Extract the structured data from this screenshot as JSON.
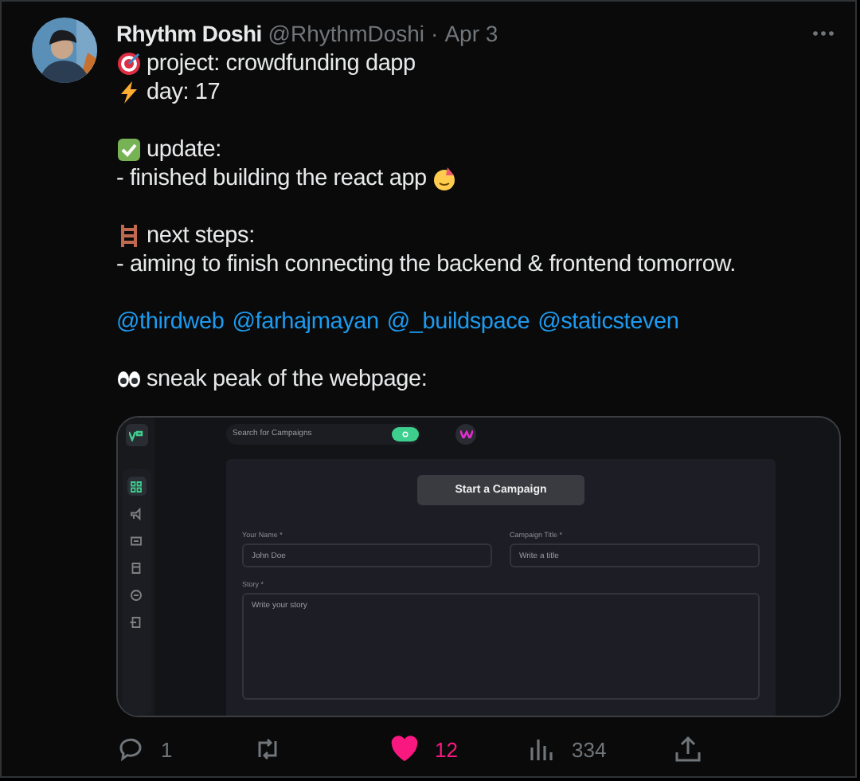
{
  "author": {
    "name": "Rhythm Doshi",
    "handle": "@RhythmDoshi",
    "separator": "·",
    "date": "Apr 3"
  },
  "paragraphs": [
    {
      "lines": [
        "project: crowdfunding dapp",
        "day: 17"
      ]
    },
    {
      "lines": [
        "update:",
        "- finished building the react app"
      ]
    },
    {
      "lines": [
        "next steps:",
        "- aiming to finish connecting the backend & frontend tomorrow."
      ]
    },
    {
      "mentions": [
        "@thirdweb",
        "@farhajmayan",
        "@_buildspace",
        "@staticsteven"
      ]
    },
    {
      "lines": [
        "sneak peak of the webpage:"
      ]
    }
  ],
  "screenshot": {
    "search": {
      "placeholder": "Search for Campaigns"
    },
    "heading_button": "Start a Campaign",
    "fields": [
      {
        "label": "Your Name *",
        "placeholder": "John Doe"
      },
      {
        "label": "Campaign Title *",
        "placeholder": "Write a title"
      }
    ],
    "story": {
      "label": "Story *",
      "placeholder": "Write your story"
    },
    "nav": [
      {
        "selected": true
      },
      {
        "selected": false
      },
      {
        "selected": false
      },
      {
        "selected": false
      },
      {
        "selected": false
      },
      {
        "selected": false
      }
    ]
  },
  "actions": [
    {
      "kind": "reply",
      "count": "1",
      "active": false
    },
    {
      "kind": "repost",
      "active": false
    },
    {
      "kind": "like",
      "count": "12",
      "active": true
    },
    {
      "kind": "views",
      "count": "334",
      "active": false
    },
    {
      "kind": "share",
      "active": false
    }
  ]
}
